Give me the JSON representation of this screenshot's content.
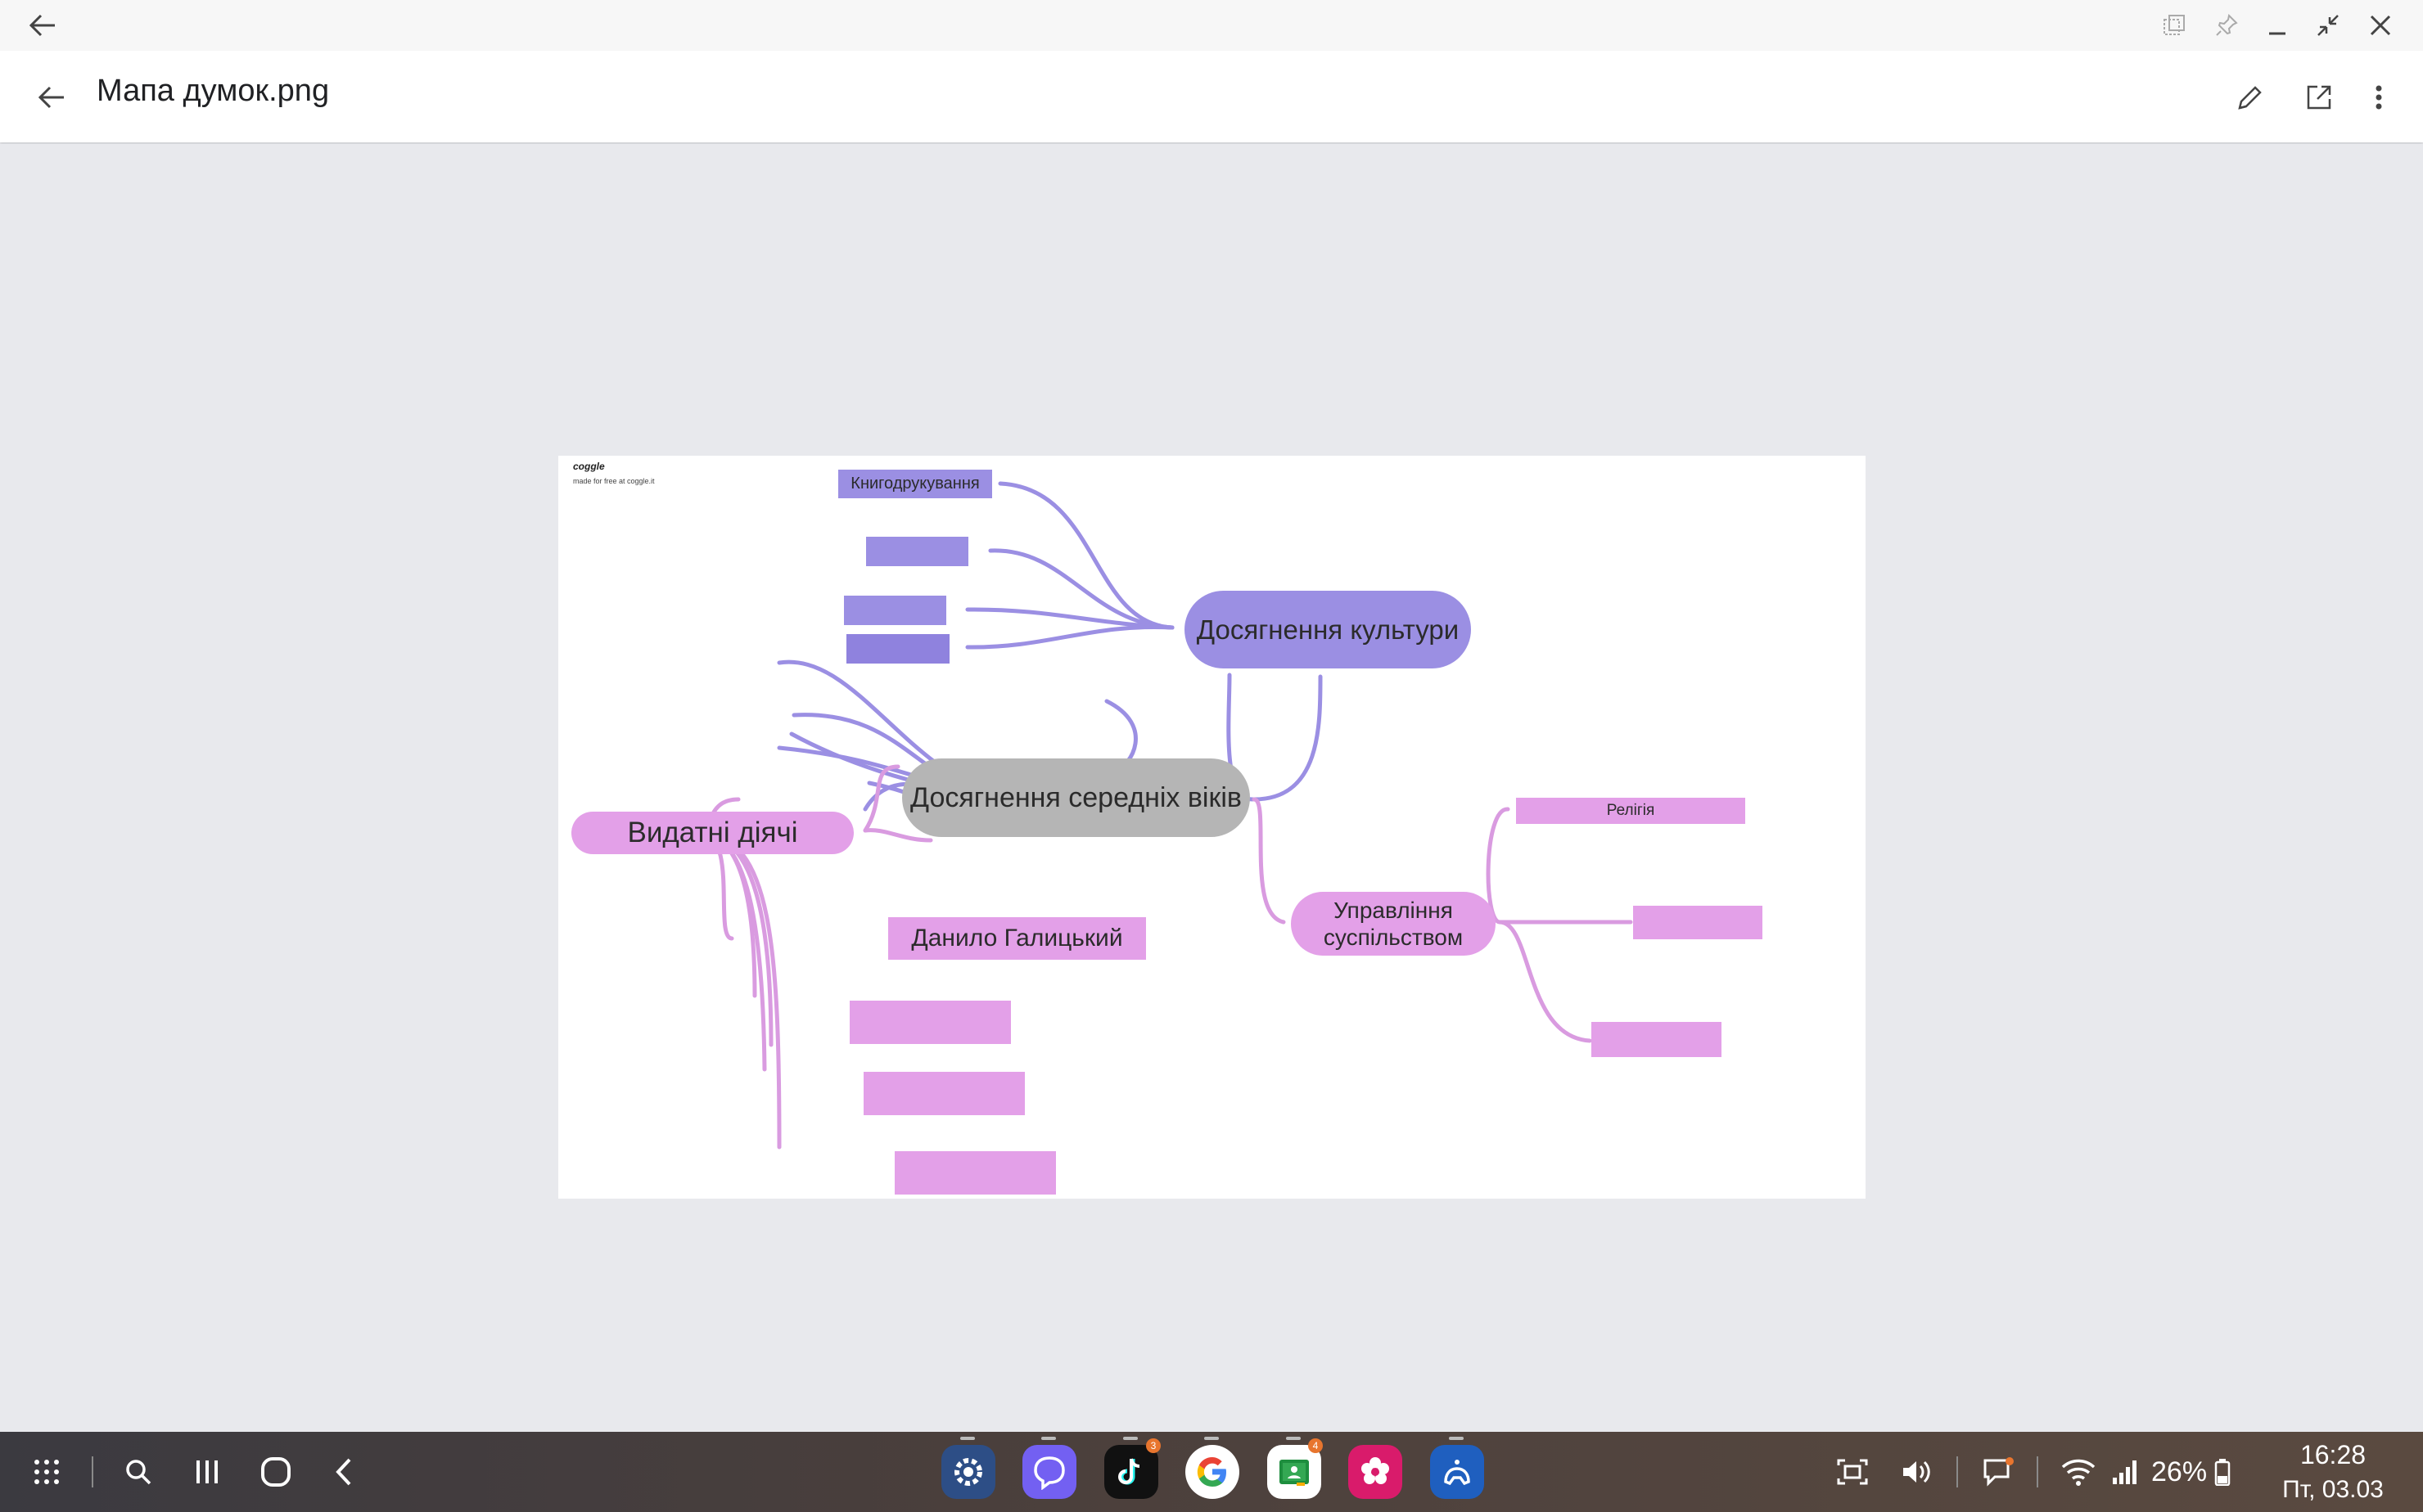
{
  "window": {
    "caption_icons": [
      "back-arrow-icon",
      "multi-window-icon",
      "pin-icon",
      "minimize-icon",
      "restore-icon",
      "close-icon"
    ]
  },
  "appbar": {
    "title": "Мапа думок.png",
    "actions": [
      "edit-pencil-icon",
      "open-external-icon",
      "more-vert-icon"
    ]
  },
  "mindmap": {
    "watermark_logo": "coggle",
    "watermark_text": "made for free at coggle.it",
    "center": "Досягнення середніх віків",
    "culture": "Досягнення культури",
    "culture_children": [
      "Книгодрукування",
      "",
      "",
      ""
    ],
    "people": "Видатні діячі",
    "people_children": [
      "Данило Галицький",
      "",
      "",
      ""
    ],
    "society": "Управління суспільством",
    "society_children": [
      "Релігія",
      "",
      ""
    ],
    "colors": {
      "violet": "#9b8fe3",
      "pink": "#e3a0e8",
      "gray": "#b5b5b5",
      "pink_line": "#d99be0",
      "violet_line": "#9b8fe3"
    }
  },
  "taskbar": {
    "left_icons": [
      "app-grid-icon",
      "search-icon",
      "recents-icon",
      "home-icon",
      "back-icon"
    ],
    "apps": [
      {
        "name": "settings-app-icon",
        "badge": ""
      },
      {
        "name": "viber-app-icon",
        "badge": ""
      },
      {
        "name": "tiktok-app-icon",
        "badge": "3"
      },
      {
        "name": "google-app-icon",
        "badge": ""
      },
      {
        "name": "classroom-app-icon",
        "badge": "4"
      },
      {
        "name": "gallery-app-icon",
        "badge": ""
      },
      {
        "name": "game-launcher-app-icon",
        "badge": ""
      }
    ],
    "battery": "26%",
    "time": "16:28",
    "date": "Пт, 03.03"
  }
}
